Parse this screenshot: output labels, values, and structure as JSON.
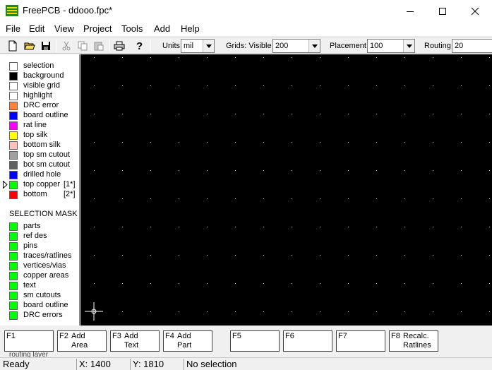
{
  "window": {
    "title": "FreePCB - ddooo.fpc*",
    "controls": [
      "minimize",
      "maximize",
      "close"
    ]
  },
  "menu": [
    "File",
    "Edit",
    "View",
    "Project",
    "Tools",
    "Add",
    "Help"
  ],
  "toolbar": {
    "buttons": [
      "new-file-icon",
      "open-folder-icon",
      "save-icon",
      "cut-icon",
      "copy-icon",
      "paste-icon",
      "print-icon",
      "help-icon"
    ],
    "units": {
      "label": "Units",
      "value": "mil"
    },
    "grids": {
      "label": "Grids: Visible",
      "value": "200"
    },
    "placement": {
      "label": "Placement",
      "value": "100"
    },
    "routing": {
      "label": "Routing",
      "value": "20"
    }
  },
  "layers": [
    {
      "label": "selection",
      "color": "#ffffff"
    },
    {
      "label": "background",
      "color": "#000000"
    },
    {
      "label": "visible grid",
      "color": "#ffffff"
    },
    {
      "label": "highlight",
      "color": "#ffffff"
    },
    {
      "label": "DRC error",
      "color": "#ff8040"
    },
    {
      "label": "board outline",
      "color": "#0000ff"
    },
    {
      "label": "rat line",
      "color": "#ff00ff"
    },
    {
      "label": "top silk",
      "color": "#ffff00"
    },
    {
      "label": "bottom silk",
      "color": "#ffc0c0"
    },
    {
      "label": "top sm cutout",
      "color": "#a0a0a0"
    },
    {
      "label": "bot sm cutout",
      "color": "#606060"
    },
    {
      "label": "drilled hole",
      "color": "#0000ff"
    },
    {
      "label": "top copper",
      "extra": "[1*]",
      "color": "#00ff00",
      "active": true
    },
    {
      "label": "bottom",
      "extra": "[2*]",
      "color": "#ff0000"
    }
  ],
  "selection_mask": {
    "heading": "SELECTION MASK",
    "items": [
      {
        "label": "parts",
        "color": "#00ff00"
      },
      {
        "label": "ref des",
        "color": "#00ff00"
      },
      {
        "label": "pins",
        "color": "#00ff00"
      },
      {
        "label": "traces/ratlines",
        "color": "#00ff00"
      },
      {
        "label": "vertices/vias",
        "color": "#00ff00"
      },
      {
        "label": "copper areas",
        "color": "#00ff00"
      },
      {
        "label": "text",
        "color": "#00ff00"
      },
      {
        "label": "sm cutouts",
        "color": "#00ff00"
      },
      {
        "label": "board outline",
        "color": "#00ff00"
      },
      {
        "label": "DRC errors",
        "color": "#00ff00"
      }
    ]
  },
  "function_keys": [
    {
      "key": "F1",
      "label": ""
    },
    {
      "key": "F2",
      "label": "Add\nArea"
    },
    {
      "key": "F3",
      "label": "Add\nText"
    },
    {
      "key": "F4",
      "label": "Add\nPart"
    },
    {
      "key": "F5",
      "label": ""
    },
    {
      "key": "F6",
      "label": ""
    },
    {
      "key": "F7",
      "label": ""
    },
    {
      "key": "F8",
      "label": "Recalc.\nRatlines"
    }
  ],
  "partial_text": "routing layer",
  "status": {
    "ready": "Ready",
    "x": "X: 1400",
    "y": "Y: 1810",
    "selection": "No selection"
  },
  "colors": {
    "canvas_background": "#000000",
    "grid_dot": "#cfcfcf",
    "cursor": "#ffffff"
  }
}
